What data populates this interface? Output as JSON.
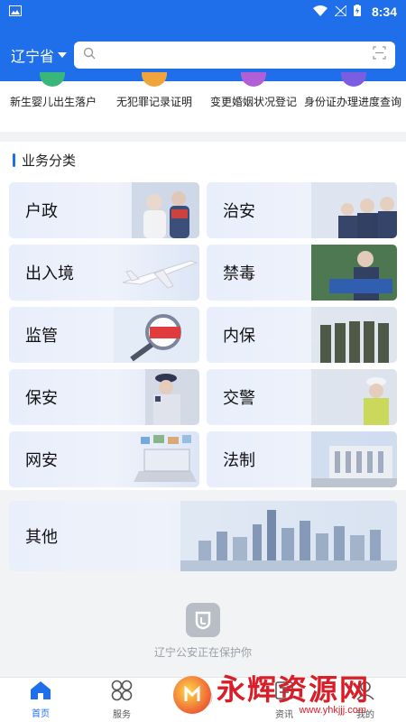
{
  "status_bar": {
    "time": "8:34"
  },
  "header": {
    "region": "辽宁省",
    "search_placeholder": ""
  },
  "quick_items": [
    {
      "label": "新生婴儿出生落户",
      "color": "#39b77a"
    },
    {
      "label": "无犯罪记录证明",
      "color": "#f0a43a"
    },
    {
      "label": "变更婚姻状况登记",
      "color": "#b15fd6"
    },
    {
      "label": "身份证办理进度查询",
      "color": "#7b5de0"
    }
  ],
  "categories": {
    "title": "业务分类",
    "items": [
      {
        "label": "户政",
        "icon": "household-photo"
      },
      {
        "label": "治安",
        "icon": "police-officers-photo"
      },
      {
        "label": "出入境",
        "icon": "airplane-photo"
      },
      {
        "label": "禁毒",
        "icon": "anti-drug-photo"
      },
      {
        "label": "监管",
        "icon": "magnifier-photo"
      },
      {
        "label": "内保",
        "icon": "police-team-photo"
      },
      {
        "label": "保安",
        "icon": "security-guard-photo"
      },
      {
        "label": "交警",
        "icon": "traffic-police-photo"
      },
      {
        "label": "网安",
        "icon": "laptop-photo"
      },
      {
        "label": "法制",
        "icon": "building-photo"
      }
    ],
    "other": {
      "label": "其他",
      "icon": "city-skyline-photo"
    }
  },
  "protect_text": "辽宁公安正在保护你",
  "tabs": [
    {
      "label": "首页",
      "icon": "home-icon",
      "active": true
    },
    {
      "label": "服务",
      "icon": "grid-icon",
      "active": false
    },
    {
      "label": "",
      "icon": "center-icon",
      "active": false
    },
    {
      "label": "资讯",
      "icon": "news-icon",
      "active": false
    },
    {
      "label": "我的",
      "icon": "user-icon",
      "active": false
    }
  ],
  "watermark": {
    "title": "永辉资源网",
    "url": "www.yhkjjj.com"
  },
  "colors": {
    "primary": "#1f6fea"
  }
}
